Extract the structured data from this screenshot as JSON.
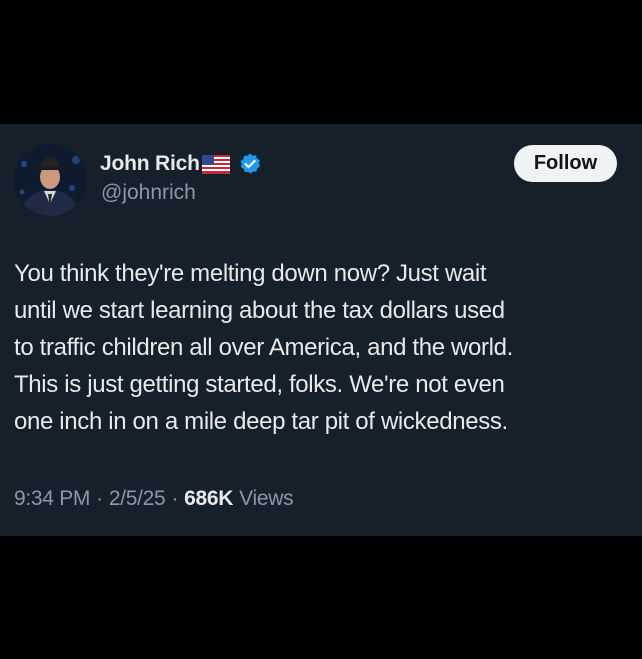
{
  "author": {
    "display_name": "John Rich",
    "handle": "@johnrich"
  },
  "follow_label": "Follow",
  "tweet": {
    "lines": [
      "You think they're melting down now? Just wait",
      "until we start learning about the tax dollars used",
      "to traffic children all over America, and the world.",
      "This is just getting started, folks. We're not even",
      "one inch in on a mile deep tar pit of wickedness."
    ]
  },
  "meta": {
    "time": "9:34 PM",
    "separator": "·",
    "date": "2/5/25",
    "views_count": "686K",
    "views_label": "Views"
  },
  "icons": {
    "flag": "us-flag-icon",
    "verified": "verified-badge-icon"
  },
  "colors": {
    "background": "#000000",
    "card": "#15202b",
    "text_primary": "#e7e9ea",
    "text_secondary": "#8b98a5",
    "verified": "#1d9bf0",
    "follow_bg": "#eff3f4"
  }
}
